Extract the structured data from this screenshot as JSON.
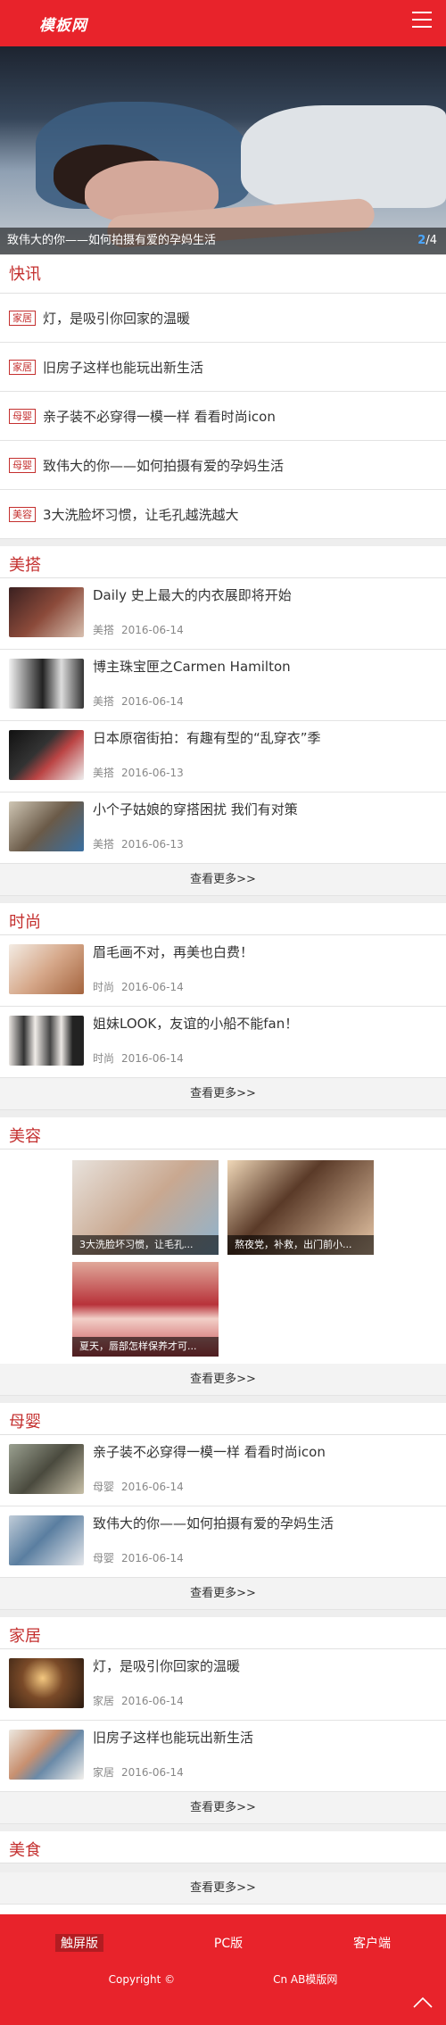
{
  "header": {
    "logo": "模板网"
  },
  "banner": {
    "caption": "致伟大的你——如何拍摄有爱的孕妈生活",
    "current": "2",
    "total": "/4"
  },
  "kuaixun": {
    "title": "快讯",
    "items": [
      {
        "tag": "家居",
        "text": "灯，是吸引你回家的温暖"
      },
      {
        "tag": "家居",
        "text": "旧房子这样也能玩出新生活"
      },
      {
        "tag": "母婴",
        "text": "亲子装不必穿得一模一样 看看时尚icon"
      },
      {
        "tag": "母婴",
        "text": "致伟大的你——如何拍摄有爱的孕妈生活"
      },
      {
        "tag": "美容",
        "text": "3大洗脸坏习惯，让毛孔越洗越大"
      }
    ]
  },
  "meida": {
    "title": "美搭",
    "items": [
      {
        "title": "Daily 史上最大的内衣展即将开始",
        "cat": "美搭",
        "date": "2016-06-14"
      },
      {
        "title": "博主珠宝匣之Carmen Hamilton",
        "cat": "美搭",
        "date": "2016-06-14"
      },
      {
        "title": "日本原宿街拍：有趣有型的“乱穿衣”季",
        "cat": "美搭",
        "date": "2016-06-13"
      },
      {
        "title": "小个子姑娘的穿搭困扰 我们有对策",
        "cat": "美搭",
        "date": "2016-06-13"
      }
    ],
    "more": "查看更多>>"
  },
  "shishang": {
    "title": "时尚",
    "items": [
      {
        "title": "眉毛画不对，再美也白费！",
        "cat": "时尚",
        "date": "2016-06-14"
      },
      {
        "title": "姐妹LOOK，友谊的小船不能fan！",
        "cat": "时尚",
        "date": "2016-06-14"
      }
    ],
    "more": "查看更多>>"
  },
  "meirong": {
    "title": "美容",
    "cards": [
      {
        "caption": "3大洗脸坏习惯，让毛孔..."
      },
      {
        "caption": "熬夜党，补救，出门前小..."
      },
      {
        "caption": "夏天，唇部怎样保养才可..."
      }
    ],
    "more": "查看更多>>"
  },
  "muying": {
    "title": "母婴",
    "items": [
      {
        "title": "亲子装不必穿得一模一样 看看时尚icon",
        "cat": "母婴",
        "date": "2016-06-14"
      },
      {
        "title": "致伟大的你——如何拍摄有爱的孕妈生活",
        "cat": "母婴",
        "date": "2016-06-14"
      }
    ],
    "more": "查看更多>>"
  },
  "jiaju": {
    "title": "家居",
    "items": [
      {
        "title": "灯，是吸引你回家的温暖",
        "cat": "家居",
        "date": "2016-06-14"
      },
      {
        "title": "旧房子这样也能玩出新生活",
        "cat": "家居",
        "date": "2016-06-14"
      }
    ],
    "more": "查看更多>>"
  },
  "meishi": {
    "title": "美食",
    "more": "查看更多>>"
  },
  "footer": {
    "links": [
      "触屏版",
      "PC版",
      "客户端"
    ],
    "copyright": "Copyright ©",
    "site": "Cn AB模版网"
  }
}
